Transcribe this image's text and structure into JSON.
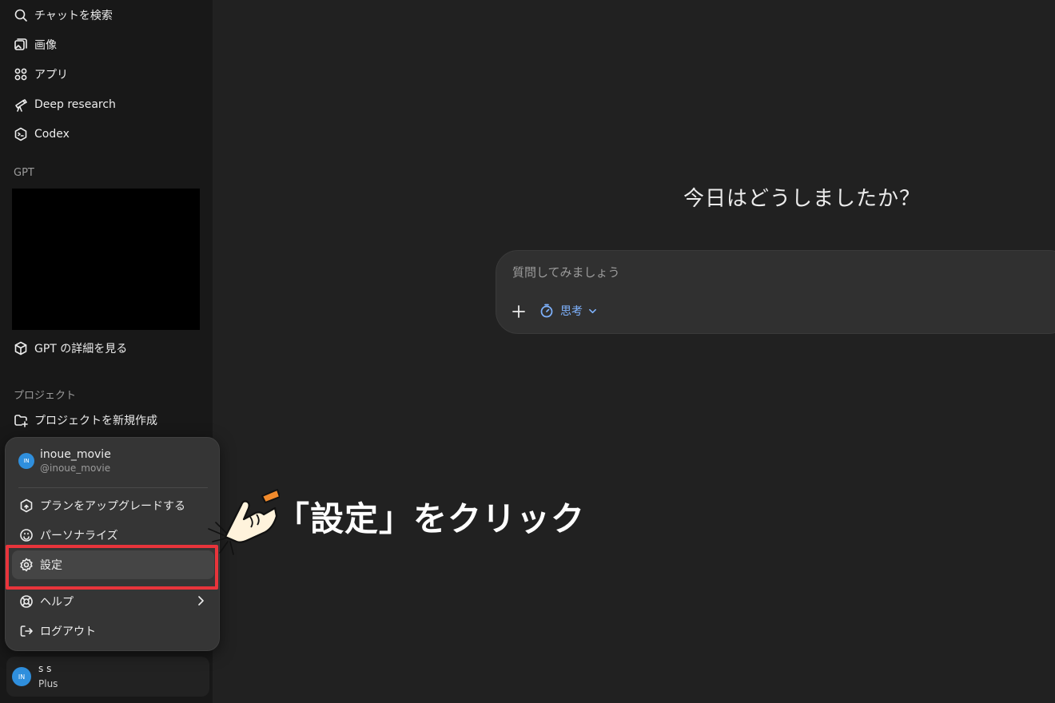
{
  "sidebar": {
    "nav": [
      {
        "label": "チャットを検索",
        "icon": "search-icon"
      },
      {
        "label": "画像",
        "icon": "images-icon"
      },
      {
        "label": "アプリ",
        "icon": "apps-icon"
      },
      {
        "label": "Deep research",
        "icon": "telescope-icon"
      },
      {
        "label": "Codex",
        "icon": "codex-icon"
      }
    ],
    "gpt_section_label": "GPT",
    "gpt_explore_label": "GPT の詳細を見る",
    "project_section_label": "プロジェクト",
    "new_project_label": "プロジェクトを新規作成"
  },
  "main": {
    "greeting": "今日はどうしましたか？",
    "composer": {
      "placeholder": "質問してみましょう",
      "think_label": "思考"
    }
  },
  "popup": {
    "avatar_initials": "IN",
    "name": "inoue_movie",
    "handle": "@inoue_movie",
    "items": [
      {
        "label": "プランをアップグレードする",
        "icon": "upgrade-icon"
      },
      {
        "label": "パーソナライズ",
        "icon": "personalize-icon"
      },
      {
        "label": "設定",
        "icon": "gear-icon"
      },
      {
        "label": "ヘルプ",
        "icon": "help-icon"
      },
      {
        "label": "ログアウト",
        "icon": "logout-icon"
      }
    ]
  },
  "account": {
    "avatar_initials": "IN",
    "name": "s s",
    "plan": "Plus"
  },
  "annotation": {
    "text": "「設定」をクリック",
    "highlight_color": "#e8343b"
  }
}
